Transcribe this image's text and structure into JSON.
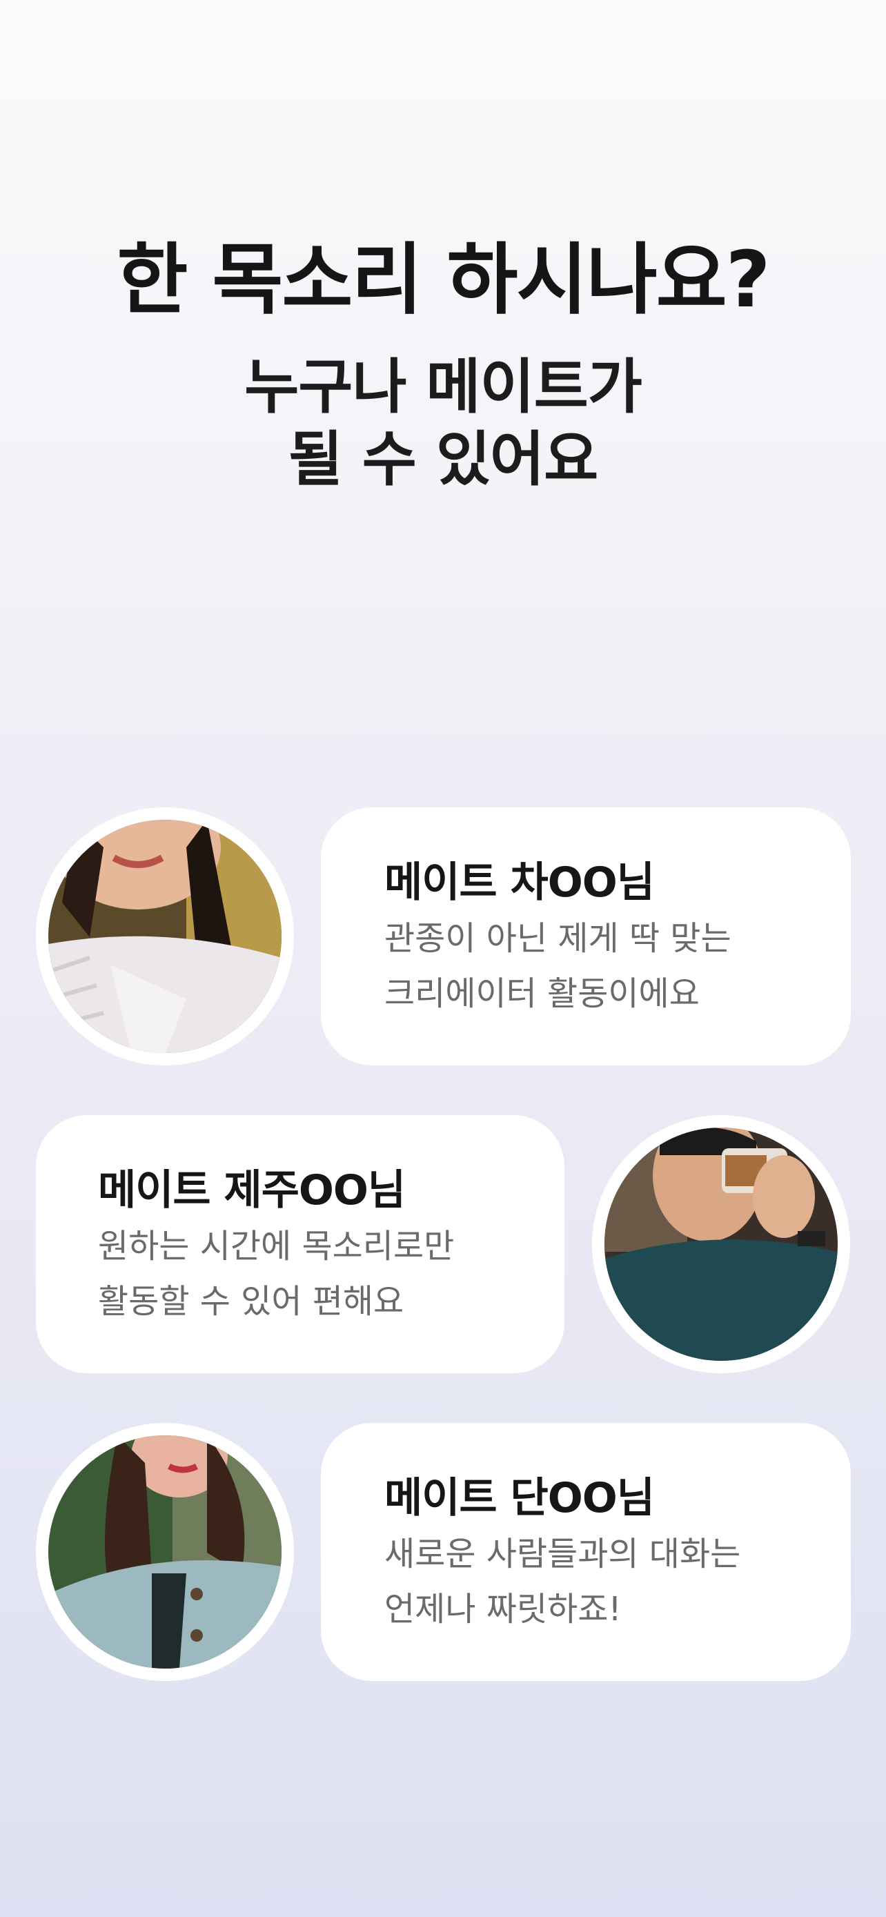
{
  "headline": "한 목소리 하시나요?",
  "subline": [
    "누구나 메이트가",
    "될 수 있어요"
  ],
  "testimonials": [
    {
      "name": "메이트 차OO님",
      "lines": [
        "관종이 아닌 제게 딱 맞는",
        "크리에이터 활동이에요"
      ],
      "avatar": "woman-white-sweater-photo"
    },
    {
      "name": "메이트 제주OO님",
      "lines": [
        "원하는 시간에 목소리로만",
        "활동할 수 있어 편해요"
      ],
      "avatar": "man-drinking-coffee-photo"
    },
    {
      "name": "메이트 단OO님",
      "lines": [
        "새로운 사람들과의 대화는",
        "언제나 짜릿하죠!"
      ],
      "avatar": "woman-blue-coat-photo"
    }
  ]
}
